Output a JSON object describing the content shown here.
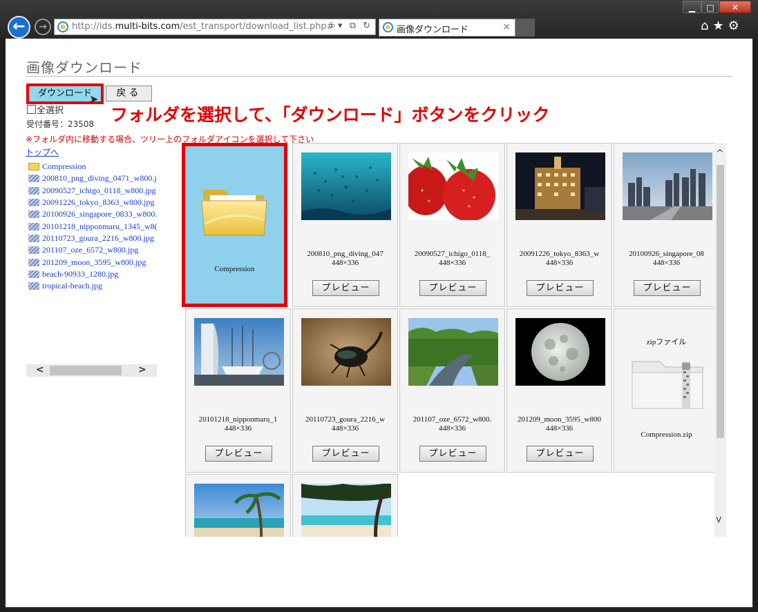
{
  "window": {
    "minimize_label": "▁",
    "maximize_label": "□",
    "close_label": "✕"
  },
  "browser": {
    "back_label": "←",
    "forward_label": "→",
    "url_prefix": "http://ids.",
    "url_host": "multi-bits.com",
    "url_path": "/est_transport/download_list.php#",
    "address_icons": "⌕▾ ⧉ ↻",
    "tab_title": "画像ダウンロード",
    "tab_close": "×",
    "toolbar_icons": "⌂★⚙",
    "icons": [
      "back-arrow-icon",
      "forward-arrow-icon",
      "ie-logo-icon",
      "search-icon",
      "compat-icon",
      "refresh-icon",
      "home-icon",
      "favorites-star-icon",
      "gear-icon"
    ]
  },
  "page": {
    "title": "画像ダウンロード",
    "download_button": "ダウンロード",
    "return_button": "戻る",
    "select_all": "全選択",
    "annotation": "フォルダを選択して、「ダウンロード」ボタンをクリック",
    "receipt": "受付番号：23508",
    "notice": "※フォルダ内に移動する場合、ツリー上のフォルダアイコンを選択して下さい",
    "top_link": "トップへ"
  },
  "tree": [
    {
      "type": "folder",
      "label": "Compression"
    },
    {
      "type": "file",
      "label": "200810_png_diving_0471_w800.j"
    },
    {
      "type": "file",
      "label": "20090527_ichigo_0118_w800.jpg"
    },
    {
      "type": "file",
      "label": "20091226_tokyo_8363_w800.jpg"
    },
    {
      "type": "file",
      "label": "20100926_singapore_0833_w800."
    },
    {
      "type": "file",
      "label": "20101218_nipponmaru_1345_w8("
    },
    {
      "type": "file",
      "label": "20110723_goura_2216_w800.jpg"
    },
    {
      "type": "file",
      "label": "201107_oze_6572_w800.jpg"
    },
    {
      "type": "file",
      "label": "201209_moon_3595_w800.jpg"
    },
    {
      "type": "file",
      "label": "beach-90933_1280.jpg"
    },
    {
      "type": "file",
      "label": "tropical-beach.jpg"
    }
  ],
  "scroll": {
    "left_arrow": "<",
    "right_arrow": ">",
    "up_arrow": "^",
    "down_arrow": "v"
  },
  "grid": {
    "folder": {
      "label": "Compression"
    },
    "preview_label": "プレビュー",
    "items": [
      {
        "name": "200810_png_diving_047",
        "dims": "448×336",
        "image": "underwater-fish"
      },
      {
        "name": "20090527_ichigo_0118_",
        "dims": "448×336",
        "image": "strawberries"
      },
      {
        "name": "20091226_tokyo_8363_w",
        "dims": "448×336",
        "image": "tokyo-night-building"
      },
      {
        "name": "20100926_singapore_08",
        "dims": "448×336",
        "image": "singapore-skyline"
      },
      {
        "name": "20101218_nipponmaru_1",
        "dims": "448×336",
        "image": "sailing-ship-harbor"
      },
      {
        "name": "20110723_goura_2216_w",
        "dims": "448×336",
        "image": "beetle"
      },
      {
        "name": "201107_oze_6572_w800.",
        "dims": "448×336",
        "image": "river-forest"
      },
      {
        "name": "201209_moon_3595_w800",
        "dims": "448×336",
        "image": "full-moon"
      }
    ],
    "zip": {
      "heading": "zipファイル",
      "label": "Compression.zip"
    },
    "partial_items": [
      {
        "image": "tropical-beach-palms"
      },
      {
        "image": "tropical-beach-tree"
      }
    ]
  }
}
